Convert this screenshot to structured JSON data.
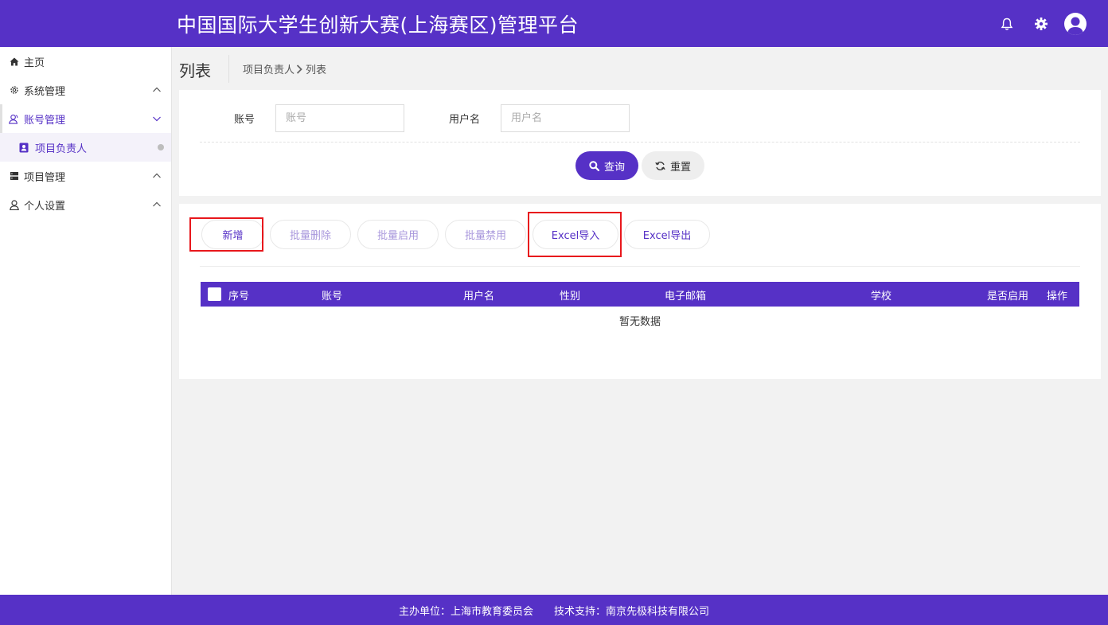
{
  "header": {
    "title": "中国国际大学生创新大赛(上海赛区)管理平台"
  },
  "sidebar": {
    "items": [
      {
        "label": "主页",
        "icon": "home-icon"
      },
      {
        "label": "系统管理",
        "icon": "gear-icon"
      },
      {
        "label": "账号管理",
        "icon": "users-icon",
        "active": true
      },
      {
        "label": "项目负责人",
        "icon": "contact-card-icon",
        "sub": true
      },
      {
        "label": "项目管理",
        "icon": "server-icon"
      },
      {
        "label": "个人设置",
        "icon": "user-icon"
      }
    ]
  },
  "page": {
    "title": "列表",
    "breadcrumb": [
      "项目负责人",
      "列表"
    ]
  },
  "search": {
    "account_label": "账号",
    "account_placeholder": "账号",
    "username_label": "用户名",
    "username_placeholder": "用户名",
    "query_label": "查询",
    "reset_label": "重置"
  },
  "actions": {
    "add": "新增",
    "batch_delete": "批量删除",
    "batch_enable": "批量启用",
    "batch_disable": "批量禁用",
    "excel_import": "Excel导入",
    "excel_export": "Excel导出"
  },
  "table": {
    "columns": [
      "序号",
      "账号",
      "用户名",
      "性别",
      "电子邮箱",
      "学校",
      "是否启用",
      "操作"
    ],
    "empty_text": "暂无数据"
  },
  "footer": {
    "organizer": "主办单位：上海市教育委员会",
    "support": "技术支持：南京先极科技有限公司"
  },
  "colors": {
    "brand": "#5631c6",
    "highlight_box": "#e8171c"
  }
}
